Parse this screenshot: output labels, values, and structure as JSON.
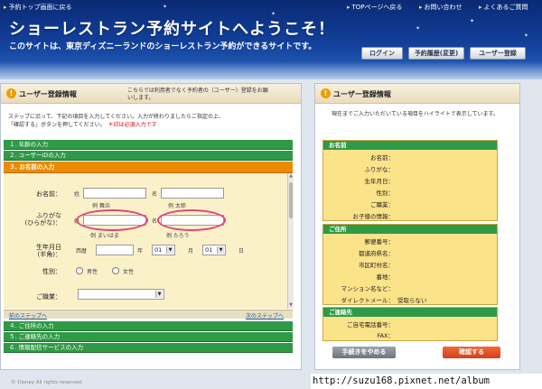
{
  "header": {
    "top_links": {
      "back": "予約トップ画面に戻る",
      "top_page": "TOPページへ戻る",
      "contact": "お問い合わせ",
      "faq": "よくあるご質問"
    },
    "title": "ショーレストラン予約サイトへようこそ！",
    "description": "このサイトは、東京ディズニーランドのショーレストラン予約ができるサイトです。",
    "buttons": {
      "login": "ログイン",
      "history": "予約履歴(変更)",
      "register": "ユーザー登録"
    }
  },
  "left_panel": {
    "title": "ユーザー登録情報",
    "note": "こちらでは利用者でなく予約者の（ユーザー）登録をお願いします。",
    "steps_note_line1": "ステップに沿って、下記の項目を入力してください。入力が終わりましたらご指定の上、",
    "steps_note_line2": "「確認する」ボタンを押してください。",
    "required_note": "＊印は必須入力です",
    "sections": {
      "s1": "１. 年齢の入力",
      "s2": "２. ユーザーIDの入力",
      "s3": "３. お名前の入力",
      "s4": "４. ご住所の入力",
      "s5": "５. ご連絡先の入力",
      "s6": "６. 情報配信サービスの入力"
    },
    "form": {
      "name_label": "お名前：",
      "sei": "姓",
      "mei": "名",
      "name_example_sei": "例 舞浜",
      "name_example_mei": "例 太郎",
      "kana_label": "ふりがな",
      "kana_label2": "(ひらがな)：",
      "kana_example_sei": "例 まいはま",
      "kana_example_mei": "例 たろう",
      "birth_label": "生年月日",
      "birth_label2": "(半角)：",
      "era": "西暦",
      "year_unit": "年",
      "month_value": "01",
      "month_unit": "月",
      "day_value": "01",
      "day_unit": "日",
      "gender_label": "性別：",
      "male": "男性",
      "female": "女性",
      "job_label": "ご職業："
    },
    "nav": {
      "prev": "前のステップへ",
      "next": "次のステップへ"
    }
  },
  "right_panel": {
    "title": "ユーザー登録情報",
    "note": "現在までご入力いただいている項目をハイライトで表示しています。",
    "groups": {
      "name": {
        "head": "お名前",
        "rows": [
          "お名前：",
          "ふりがな：",
          "生年月日：",
          "性別：",
          "ご職業：",
          "お子様の情報："
        ]
      },
      "address": {
        "head": "ご住所",
        "rows": [
          "郵便番号：",
          "都道府県名：",
          "市区町村名：",
          "番地：",
          "マンション名など：",
          "ダイレクトメール："
        ],
        "dm_value": "受取らない"
      },
      "contact": {
        "head": "ご連絡先",
        "rows": [
          "ご自宅電話番号：",
          "FAX："
        ]
      }
    },
    "buttons": {
      "cancel": "手続きをやめる",
      "confirm": "確認する"
    }
  },
  "footer": {
    "copyright": "© Disney All rights reserved.",
    "watermark": "http://suzu168.pixnet.net/album"
  }
}
